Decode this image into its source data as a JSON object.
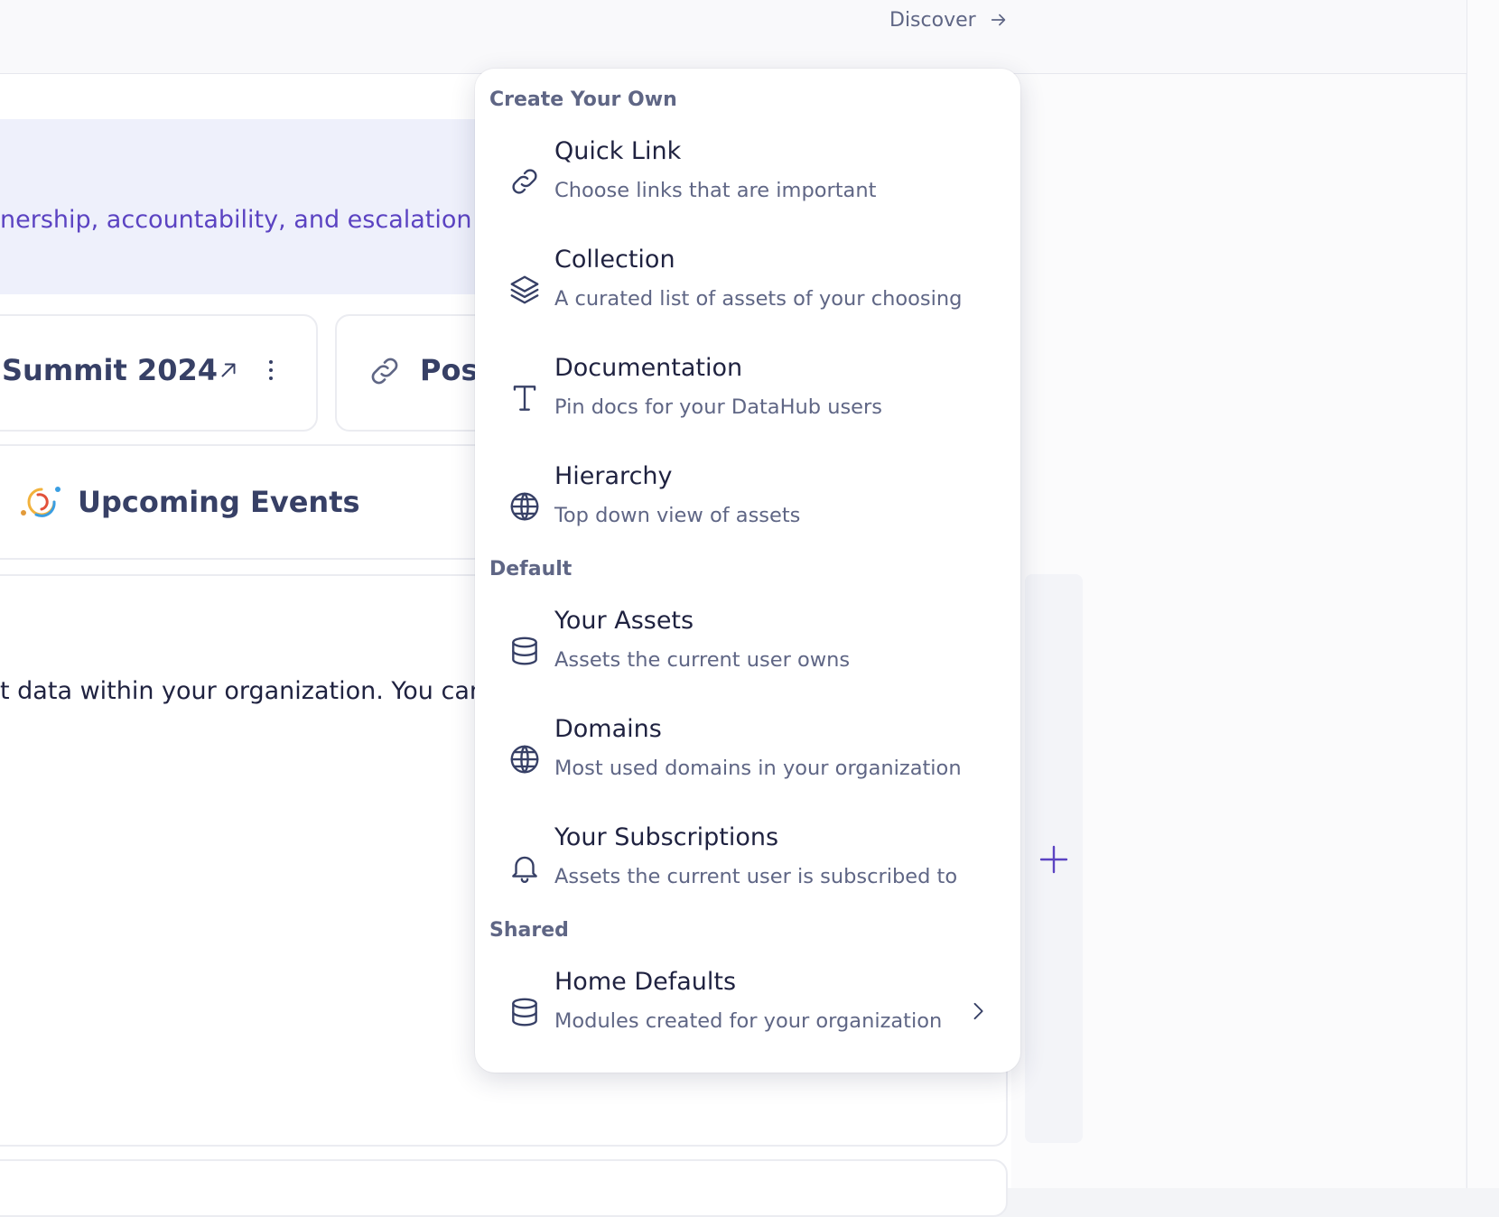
{
  "header": {
    "discover_label": "Discover"
  },
  "background": {
    "announcement_text": "nership, accountability, and escalation pc",
    "card1_title": "Summit 2024",
    "card2_title": "Post",
    "events_title": "Upcoming Events",
    "content_text": "t data within your organization. You can:"
  },
  "menu": {
    "sections": {
      "create": "Create Your Own",
      "default": "Default",
      "shared": "Shared"
    },
    "items": [
      {
        "title": "Quick Link",
        "desc": "Choose links that are important",
        "icon": "link-icon"
      },
      {
        "title": "Collection",
        "desc": "A curated list of assets of your choosing",
        "icon": "layers-icon"
      },
      {
        "title": "Documentation",
        "desc": "Pin docs for your DataHub users",
        "icon": "text-icon"
      },
      {
        "title": "Hierarchy",
        "desc": "Top down view of assets",
        "icon": "globe-icon"
      },
      {
        "title": "Your Assets",
        "desc": "Assets the current user owns",
        "icon": "database-icon"
      },
      {
        "title": "Domains",
        "desc": "Most used domains in your organization",
        "icon": "globe-icon"
      },
      {
        "title": "Your Subscriptions",
        "desc": "Assets the current user is subscribed to",
        "icon": "bell-icon"
      },
      {
        "title": "Home Defaults",
        "desc": "Modules created for your organization",
        "icon": "database-icon"
      }
    ]
  },
  "colors": {
    "accent": "#5b43c2",
    "text_primary": "#1f2240",
    "text_secondary": "#5f6685"
  }
}
